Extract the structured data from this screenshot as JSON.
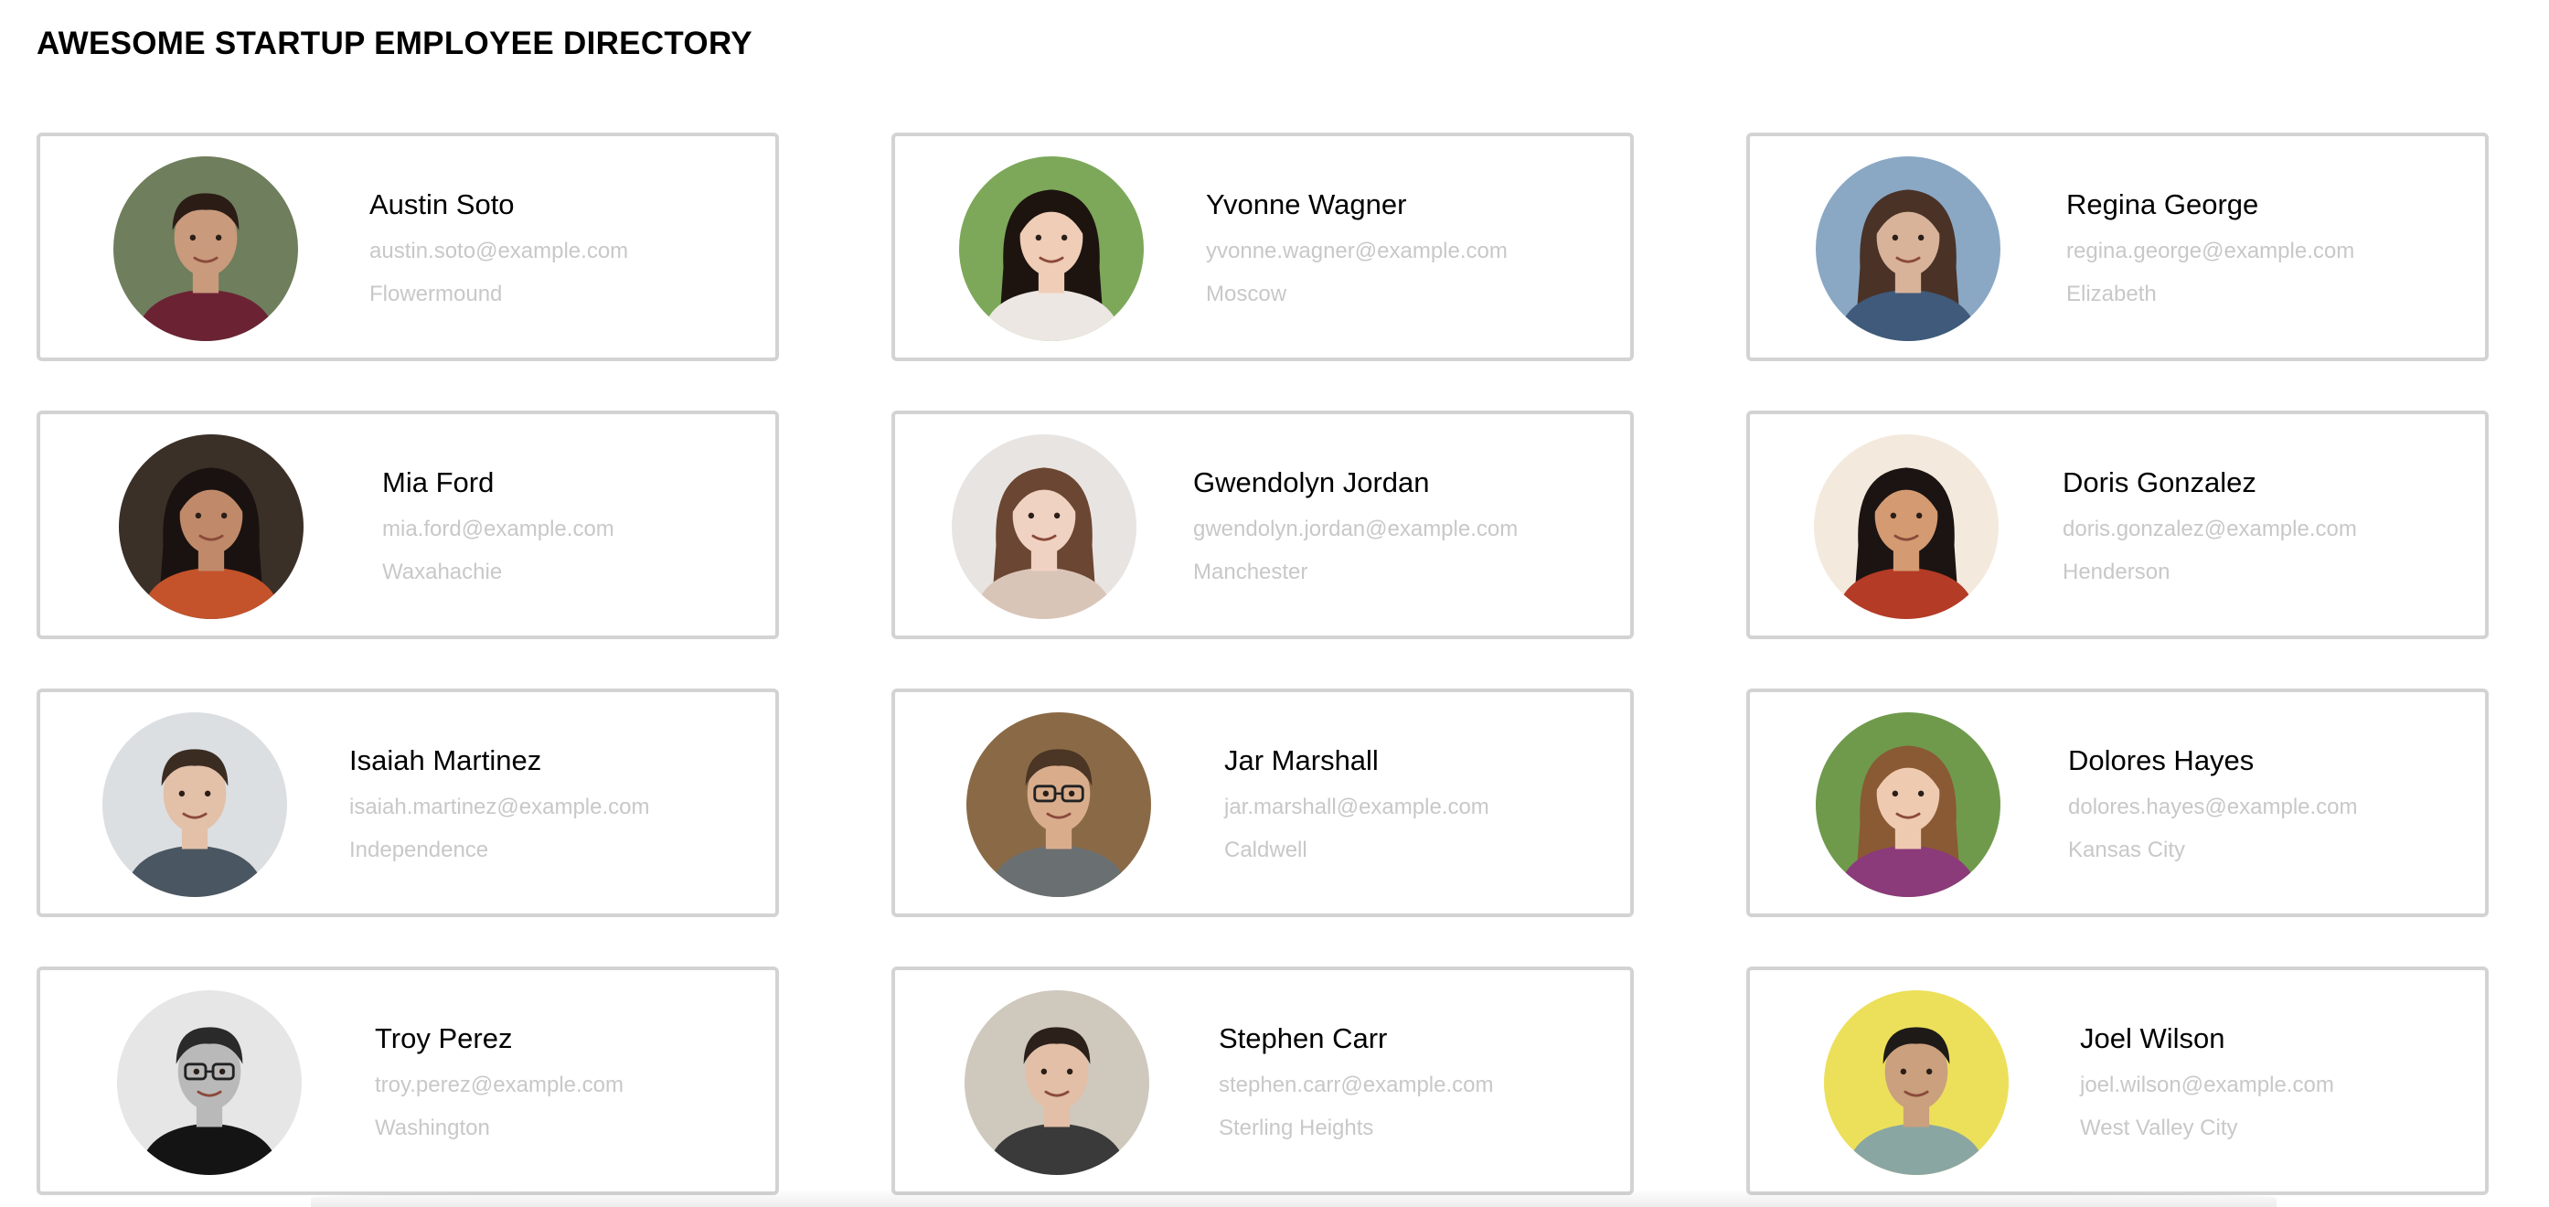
{
  "page": {
    "title": "AWESOME STARTUP EMPLOYEE DIRECTORY"
  },
  "employees": [
    {
      "name": "Austin Soto",
      "email": "austin.soto@example.com",
      "city": "Flowermound",
      "photo_icon": "portrait-man-smiling",
      "bg": "#6f7e5c",
      "skin": "#c99a7c",
      "hair": "#2b1d16",
      "shirt": "#6b2334"
    },
    {
      "name": "Yvonne Wagner",
      "email": "yvonne.wagner@example.com",
      "city": "Moscow",
      "photo_icon": "portrait-woman-smiling",
      "bg": "#7da85a",
      "skin": "#efcdb6",
      "hair": "#1d1410",
      "shirt": "#ece7e2"
    },
    {
      "name": "Regina George",
      "email": "regina.george@example.com",
      "city": "Elizabeth",
      "photo_icon": "portrait-woman",
      "bg": "#8aa8c4",
      "skin": "#d8b39a",
      "hair": "#4a3226",
      "shirt": "#3f5a7a"
    },
    {
      "name": "Mia Ford",
      "email": "mia.ford@example.com",
      "city": "Waxahachie",
      "photo_icon": "portrait-woman-smiling",
      "bg": "#3a3028",
      "skin": "#c08a6a",
      "hair": "#1a1210",
      "shirt": "#c4532b"
    },
    {
      "name": "Gwendolyn Jordan",
      "email": "gwendolyn.jordan@example.com",
      "city": "Manchester",
      "photo_icon": "portrait-woman",
      "bg": "#e8e4e1",
      "skin": "#f0d2c2",
      "hair": "#6b4632",
      "shirt": "#d9c5b8"
    },
    {
      "name": "Doris Gonzalez",
      "email": "doris.gonzalez@example.com",
      "city": "Henderson",
      "photo_icon": "portrait-woman-smiling",
      "bg": "#f3eadd",
      "skin": "#d49a72",
      "hair": "#1b1412",
      "shirt": "#b43b26"
    },
    {
      "name": "Isaiah Martinez",
      "email": "isaiah.martinez@example.com",
      "city": "Independence",
      "photo_icon": "portrait-man",
      "bg": "#dcdfe2",
      "skin": "#e3c0a8",
      "hair": "#3b2c22",
      "shirt": "#4a5662"
    },
    {
      "name": "Jar Marshall",
      "email": "jar.marshall@example.com",
      "city": "Caldwell",
      "photo_icon": "portrait-man-glasses",
      "bg": "#8a6a46",
      "skin": "#d9ad8c",
      "hair": "#4b3524",
      "shirt": "#6a6f72"
    },
    {
      "name": "Dolores Hayes",
      "email": "dolores.hayes@example.com",
      "city": "Kansas City",
      "photo_icon": "portrait-woman-smiling",
      "bg": "#6f9a4c",
      "skin": "#eecab0",
      "hair": "#8a5a34",
      "shirt": "#8b3a7a"
    },
    {
      "name": "Troy Perez",
      "email": "troy.perez@example.com",
      "city": "Washington",
      "photo_icon": "portrait-man-glasses",
      "bg": "#e6e6e6",
      "skin": "#b9b9b9",
      "hair": "#2a2a2a",
      "shirt": "#141414"
    },
    {
      "name": "Stephen Carr",
      "email": "stephen.carr@example.com",
      "city": "Sterling Heights",
      "photo_icon": "portrait-man",
      "bg": "#cfc8bd",
      "skin": "#e2bfa6",
      "hair": "#2b201a",
      "shirt": "#3a3a3a"
    },
    {
      "name": "Joel Wilson",
      "email": "joel.wilson@example.com",
      "city": "West Valley City",
      "photo_icon": "portrait-man",
      "bg": "#ece05a",
      "skin": "#caa07e",
      "hair": "#1e1a17",
      "shirt": "#8aa6a2"
    }
  ]
}
